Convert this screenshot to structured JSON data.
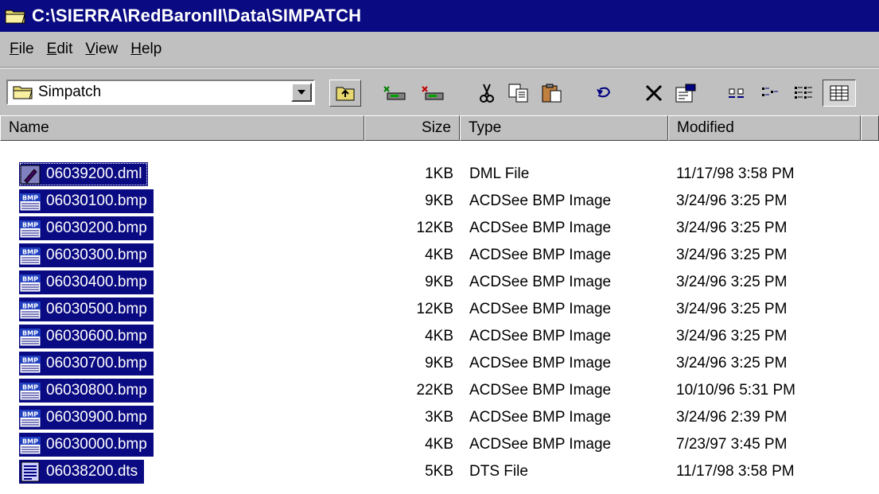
{
  "window": {
    "title": "C:\\SIERRA\\RedBaronII\\Data\\SIMPATCH"
  },
  "menu": [
    {
      "pre": "",
      "hot": "F",
      "post": "ile"
    },
    {
      "pre": "",
      "hot": "E",
      "post": "dit"
    },
    {
      "pre": "",
      "hot": "V",
      "post": "iew"
    },
    {
      "pre": "",
      "hot": "H",
      "post": "elp"
    }
  ],
  "address": {
    "value": "Simpatch"
  },
  "columns": {
    "name": "Name",
    "size": "Size",
    "type": "Type",
    "modified": "Modified"
  },
  "files": [
    {
      "name": "06039200.dml",
      "size": "1KB",
      "type": "DML File",
      "modified": "11/17/98 3:58 PM",
      "icon": "dml-file-icon",
      "selected": true
    },
    {
      "name": "06030100.bmp",
      "size": "9KB",
      "type": "ACDSee BMP Image",
      "modified": "3/24/96 3:25 PM",
      "icon": "bmp-file-icon",
      "selected": true
    },
    {
      "name": "06030200.bmp",
      "size": "12KB",
      "type": "ACDSee BMP Image",
      "modified": "3/24/96 3:25 PM",
      "icon": "bmp-file-icon",
      "selected": true
    },
    {
      "name": "06030300.bmp",
      "size": "4KB",
      "type": "ACDSee BMP Image",
      "modified": "3/24/96 3:25 PM",
      "icon": "bmp-file-icon",
      "selected": true
    },
    {
      "name": "06030400.bmp",
      "size": "9KB",
      "type": "ACDSee BMP Image",
      "modified": "3/24/96 3:25 PM",
      "icon": "bmp-file-icon",
      "selected": true
    },
    {
      "name": "06030500.bmp",
      "size": "12KB",
      "type": "ACDSee BMP Image",
      "modified": "3/24/96 3:25 PM",
      "icon": "bmp-file-icon",
      "selected": true
    },
    {
      "name": "06030600.bmp",
      "size": "4KB",
      "type": "ACDSee BMP Image",
      "modified": "3/24/96 3:25 PM",
      "icon": "bmp-file-icon",
      "selected": true
    },
    {
      "name": "06030700.bmp",
      "size": "9KB",
      "type": "ACDSee BMP Image",
      "modified": "3/24/96 3:25 PM",
      "icon": "bmp-file-icon",
      "selected": true
    },
    {
      "name": "06030800.bmp",
      "size": "22KB",
      "type": "ACDSee BMP Image",
      "modified": "10/10/96 5:31 PM",
      "icon": "bmp-file-icon",
      "selected": true
    },
    {
      "name": "06030900.bmp",
      "size": "3KB",
      "type": "ACDSee BMP Image",
      "modified": "3/24/96 2:39 PM",
      "icon": "bmp-file-icon",
      "selected": true
    },
    {
      "name": "06030000.bmp",
      "size": "4KB",
      "type": "ACDSee BMP Image",
      "modified": "7/23/97 3:45 PM",
      "icon": "bmp-file-icon",
      "selected": true
    },
    {
      "name": "06038200.dts",
      "size": "5KB",
      "type": "DTS File",
      "modified": "11/17/98 3:58 PM",
      "icon": "dts-file-icon",
      "selected": true
    }
  ],
  "icons": {
    "bmp_label": "BMP"
  },
  "colors": {
    "titlebar": "#0a0a82",
    "selection": "#0a0a82",
    "chrome": "#c0c0c0"
  }
}
